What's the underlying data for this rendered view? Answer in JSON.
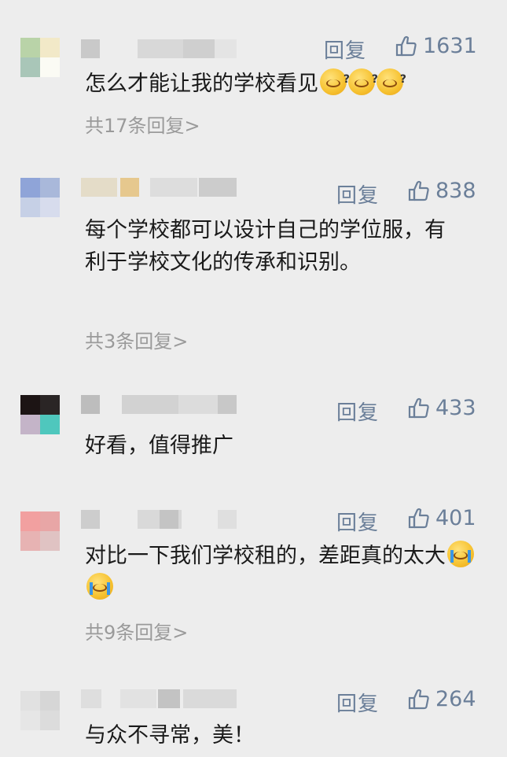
{
  "colors": {
    "background": "#ededed",
    "link_blue": "#6b7f99",
    "muted_gray": "#9a9a9a",
    "text": "#1a1a1a"
  },
  "comments": [
    {
      "text": "怎么才能让我的学校看见",
      "emoji": [
        "thinking-question-emoji",
        "thinking-question-emoji",
        "thinking-question-emoji"
      ],
      "reply_label": "回复",
      "likes": "1631",
      "replies_link": "共17条回复>",
      "avatar_colors": [
        "#b9d3a8",
        "#f2e9c8",
        "#a9c6b8",
        "#fbfbf4"
      ],
      "username_blocks": [
        "#c9c9c9",
        "#d8d8d8",
        "#cfcfcf",
        "#e4e4e4"
      ]
    },
    {
      "text": "每个学校都可以设计自己的学位服，有利于学校文化的传承和识别。",
      "emoji": [],
      "reply_label": "回复",
      "likes": "838",
      "replies_link": "共3条回复>",
      "avatar_colors": [
        "#8fa4d8",
        "#a9b8da",
        "#c6d0e6",
        "#d7dced"
      ],
      "username_blocks": [
        "#e4dcc8",
        "#e6c88e",
        "#dddddd",
        "#cccccc"
      ]
    },
    {
      "text": "好看，值得推广",
      "emoji": [],
      "reply_label": "回复",
      "likes": "433",
      "replies_link": "",
      "avatar_colors": [
        "#1c1414",
        "#2a2525",
        "#c4b4c8",
        "#4fc7bd"
      ],
      "username_blocks": [
        "#bdbdbd",
        "#d2d2d2",
        "#dcdcdc",
        "#c8c8c8"
      ]
    },
    {
      "text": "对比一下我们学校租的，差距真的太大",
      "emoji": [
        "crying-emoji",
        "crying-emoji"
      ],
      "reply_label": "回复",
      "likes": "401",
      "replies_link": "共9条回复>",
      "avatar_colors": [
        "#f2a0a0",
        "#e8a6a6",
        "#e7b3b3",
        "#e0c3c3"
      ],
      "username_blocks": [
        "#cdcdcd",
        "#d9d9d9",
        "#c4c4c4",
        "#dfdfdf"
      ]
    },
    {
      "text": "与众不寻常，美！",
      "emoji": [],
      "reply_label": "回复",
      "likes": "264",
      "replies_link": "",
      "avatar_colors": [
        "#e1e1e1",
        "#d6d6d6",
        "#e6e6e6",
        "#dcdcdc"
      ],
      "username_blocks": [
        "#dedede",
        "#e2e2e2",
        "#c3c3c3",
        "#dadada"
      ]
    }
  ]
}
